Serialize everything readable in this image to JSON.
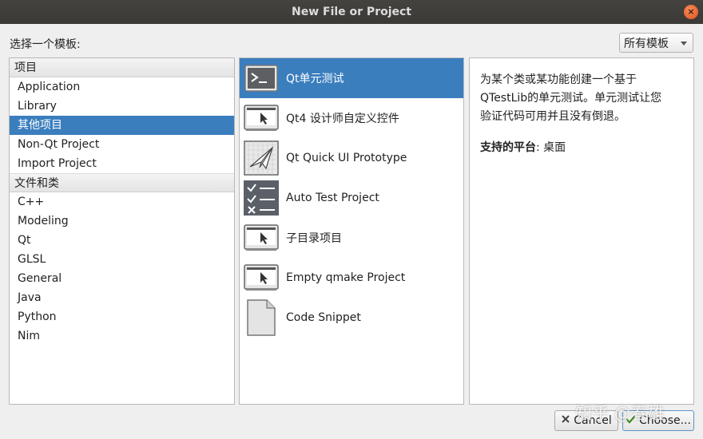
{
  "window": {
    "title": "New File or Project",
    "close_glyph": "×"
  },
  "header": {
    "template_label": "选择一个模板:",
    "filter_value": "所有模板"
  },
  "categories": {
    "groups": [
      {
        "title": "项目",
        "items": [
          "Application",
          "Library",
          "其他项目",
          "Non-Qt Project",
          "Import Project"
        ]
      },
      {
        "title": "文件和类",
        "items": [
          "C++",
          "Modeling",
          "Qt",
          "GLSL",
          "General",
          "Java",
          "Python",
          "Nim"
        ]
      }
    ],
    "selected": "其他项目"
  },
  "templates": {
    "items": [
      {
        "label": "Qt单元测试",
        "icon": "terminal-icon"
      },
      {
        "label": "Qt4 设计师自定义控件",
        "icon": "monitor-cursor-icon"
      },
      {
        "label": "Qt Quick UI Prototype",
        "icon": "paper-plane-icon"
      },
      {
        "label": "Auto Test Project",
        "icon": "checklist-icon"
      },
      {
        "label": "子目录项目",
        "icon": "monitor-cursor-icon"
      },
      {
        "label": "Empty qmake Project",
        "icon": "monitor-cursor-icon"
      },
      {
        "label": "Code Snippet",
        "icon": "document-icon"
      }
    ],
    "selected_index": 0
  },
  "description": {
    "text_lines": [
      "为某个类或某功能创建一个基于",
      "QTestLib的单元测试。单元测试让您",
      "验证代码可用并且没有倒退。"
    ],
    "platform_label": "支持的平台",
    "platform_value": ": 桌面"
  },
  "buttons": {
    "cancel_label": "Cancel",
    "choose_label": "Choose..."
  },
  "watermark": "知乎 @春雄",
  "colors": {
    "selection": "#3a7ebe",
    "titlebar": "#3e3d39"
  }
}
